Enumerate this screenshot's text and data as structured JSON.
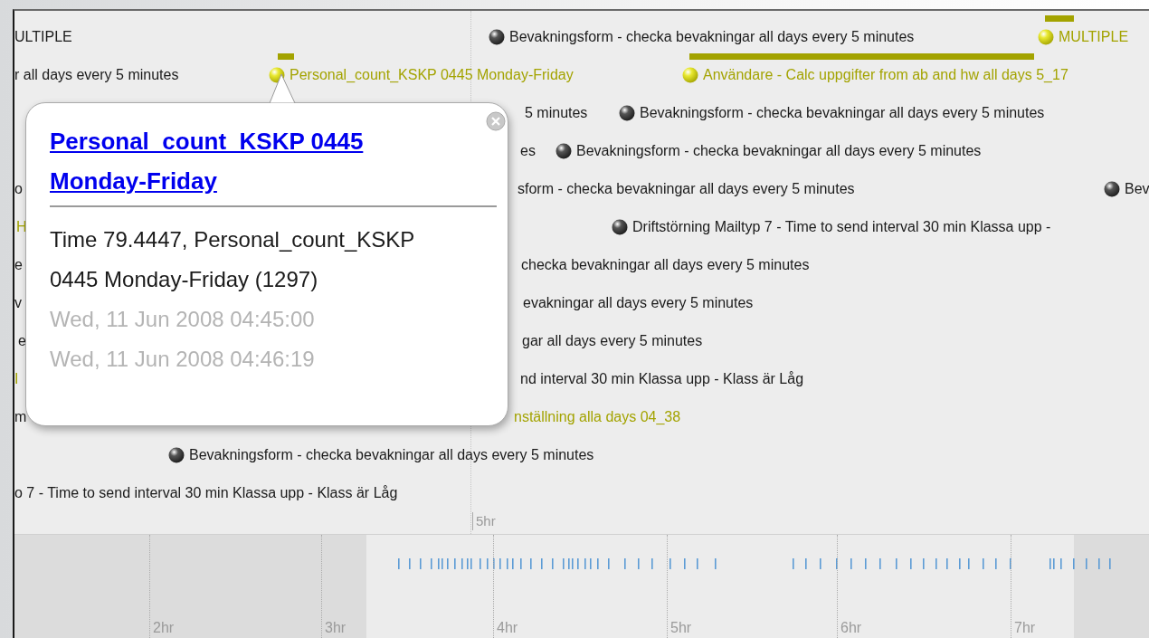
{
  "timeline": {
    "events": [
      {
        "text": "ULTIPLE",
        "kind": "text",
        "color": "#1a1a1a",
        "tape": false
      },
      {
        "text": "Bevakningsform - checka bevakningar all days every 5 minutes",
        "kind": "ball",
        "color": "#1a1a1a",
        "tape": false
      },
      {
        "text": "MULTIPLE",
        "kind": "ball",
        "color": "#a3a300",
        "tape": true
      },
      {
        "text": "r all days every 5 minutes",
        "kind": "text",
        "color": "#1a1a1a",
        "tape": false
      },
      {
        "text": "Personal_count_KSKP 0445 Monday-Friday",
        "kind": "ball",
        "color": "#a3a300",
        "tape": true
      },
      {
        "text": "Användare - Calc uppgifter from ab and hw all days 5_17",
        "kind": "ball",
        "color": "#a3a300",
        "tape": true
      },
      {
        "text": "5 minutes",
        "kind": "text",
        "color": "#1a1a1a",
        "tape": false
      },
      {
        "text": "Bevakningsform - checka bevakningar all days every 5 minutes",
        "kind": "ball",
        "color": "#1a1a1a",
        "tape": false
      },
      {
        "text": "es",
        "kind": "text",
        "color": "#1a1a1a",
        "tape": false
      },
      {
        "text": "Bevakningsform - checka bevakningar all days every 5 minutes",
        "kind": "ball",
        "color": "#1a1a1a",
        "tape": false
      },
      {
        "text": "o",
        "kind": "text",
        "color": "#1a1a1a",
        "tape": false
      },
      {
        "text": "sform - checka bevakningar all days every 5 minutes",
        "kind": "text",
        "color": "#1a1a1a",
        "tape": false
      },
      {
        "text": "Bev",
        "kind": "ball",
        "color": "#1a1a1a",
        "tape": false
      },
      {
        "text": "H",
        "kind": "text",
        "color": "#a3a300",
        "tape": false
      },
      {
        "text": "Driftstörning Mailtyp 7 - Time to send interval 30 min Klassa upp -",
        "kind": "ball",
        "color": "#1a1a1a",
        "tape": false
      },
      {
        "text": "e",
        "kind": "text",
        "color": "#1a1a1a",
        "tape": false
      },
      {
        "text": "checka bevakningar all days every 5 minutes",
        "kind": "text",
        "color": "#1a1a1a",
        "tape": false
      },
      {
        "text": "v",
        "kind": "text",
        "color": "#1a1a1a",
        "tape": false
      },
      {
        "text": "evakningar all days every 5 minutes",
        "kind": "text",
        "color": "#1a1a1a",
        "tape": false
      },
      {
        "text": "e",
        "kind": "text",
        "color": "#1a1a1a",
        "tape": false
      },
      {
        "text": "gar all days every 5 minutes",
        "kind": "text",
        "color": "#1a1a1a",
        "tape": false
      },
      {
        "text": "I",
        "kind": "text",
        "color": "#a3a300",
        "tape": false
      },
      {
        "text": "nd interval 30 min Klassa upp - Klass är Låg",
        "kind": "text",
        "color": "#1a1a1a",
        "tape": false
      },
      {
        "text": "m",
        "kind": "text",
        "color": "#1a1a1a",
        "tape": false
      },
      {
        "text": "nställning alla days 04_38",
        "kind": "text",
        "color": "#a3a300",
        "tape": false
      },
      {
        "text": "Bevakningsform - checka bevakningar all days every 5 minutes",
        "kind": "ball",
        "color": "#1a1a1a",
        "tape": false
      },
      {
        "text": "o 7 - Time to send interval 30 min Klassa upp - Klass är Låg",
        "kind": "text",
        "color": "#1a1a1a",
        "tape": false
      }
    ],
    "scale_label": "5hr",
    "popup": {
      "title": "Personal_count_KSKP 0445 Monday-Friday",
      "body": "Time 79.4447, Personal_count_KSKP 0445 Monday-Friday (1297)",
      "start": "Wed, 11 Jun 2008 04:45:00",
      "end": "Wed, 11 Jun 2008 04:46:19"
    }
  },
  "overview": {
    "labels": [
      "2hr",
      "3hr",
      "4hr",
      "5hr",
      "6hr",
      "7hr"
    ]
  }
}
